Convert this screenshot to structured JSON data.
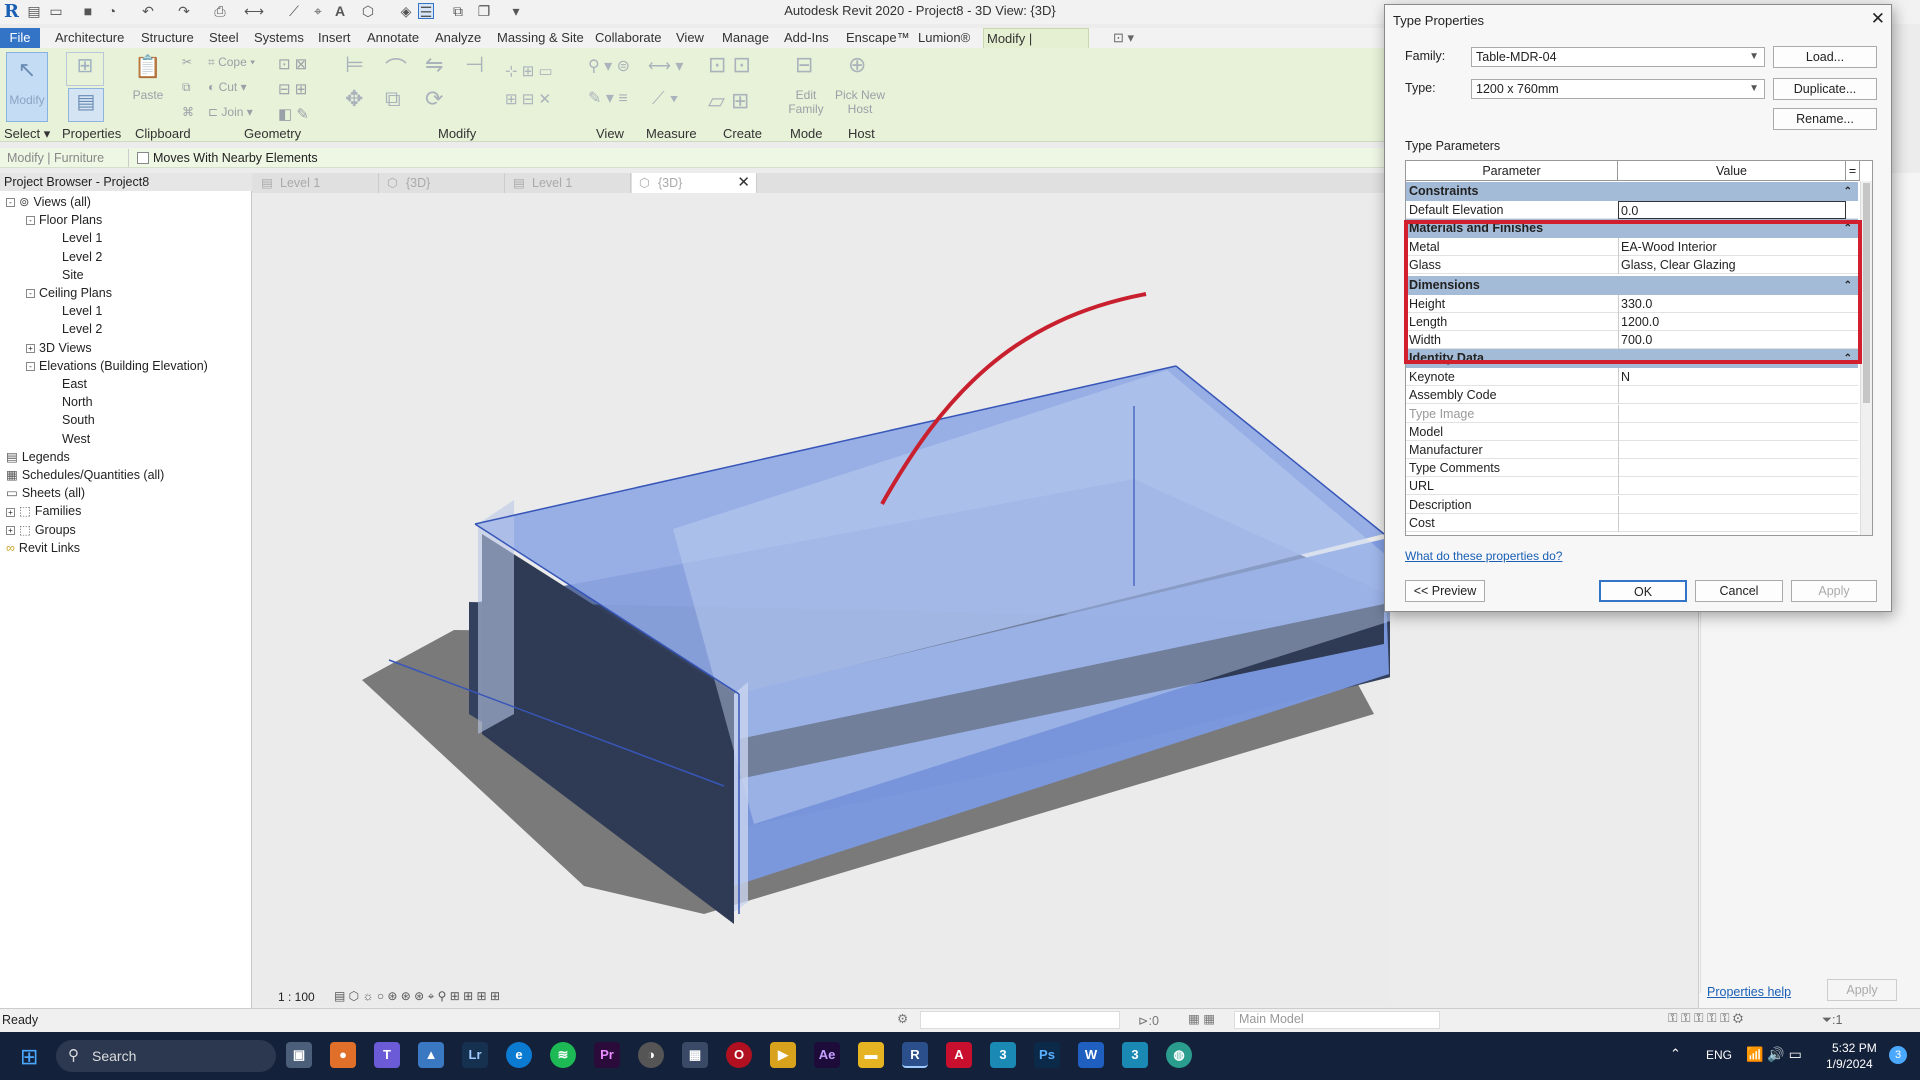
{
  "app": {
    "title": "Autodesk Revit 2020 - Project8 - 3D View: {3D}",
    "logo": "R"
  },
  "tabs": [
    "File",
    "Architecture",
    "Structure",
    "Steel",
    "Systems",
    "Insert",
    "Annotate",
    "Analyze",
    "Massing & Site",
    "Collaborate",
    "View",
    "Manage",
    "Add-Ins",
    "Enscape™",
    "Lumion®",
    "Modify | Furniture"
  ],
  "ribbon": {
    "modify_label": "Modify",
    "properties_label": "Properties",
    "paste_label": "Paste",
    "cope_label": "Cope",
    "cut_label": "Cut",
    "join_label": "Join",
    "edit_family_label": "Edit Family",
    "pick_new_host_label": "Pick New Host",
    "groups": [
      "Select",
      "Properties",
      "Clipboard",
      "Geometry",
      "Modify",
      "View",
      "Measure",
      "Create",
      "Mode",
      "Host"
    ]
  },
  "options_bar": {
    "context": "Modify | Furniture",
    "checkbox_label": "Moves With Nearby Elements"
  },
  "project_browser": {
    "header": "Project Browser - Project8",
    "items": [
      {
        "label": "Views (all)",
        "level": 0,
        "toggle": "-"
      },
      {
        "label": "Floor Plans",
        "level": 1,
        "toggle": "-"
      },
      {
        "label": "Level 1",
        "level": 2
      },
      {
        "label": "Level 2",
        "level": 2
      },
      {
        "label": "Site",
        "level": 2
      },
      {
        "label": "Ceiling Plans",
        "level": 1,
        "toggle": "-"
      },
      {
        "label": "Level 1",
        "level": 2
      },
      {
        "label": "Level 2",
        "level": 2
      },
      {
        "label": "3D Views",
        "level": 1,
        "toggle": "+"
      },
      {
        "label": "Elevations (Building Elevation)",
        "level": 1,
        "toggle": "-"
      },
      {
        "label": "East",
        "level": 2
      },
      {
        "label": "North",
        "level": 2
      },
      {
        "label": "South",
        "level": 2
      },
      {
        "label": "West",
        "level": 2
      },
      {
        "label": "Legends",
        "level": 0
      },
      {
        "label": "Schedules/Quantities (all)",
        "level": 0
      },
      {
        "label": "Sheets (all)",
        "level": 0
      },
      {
        "label": "Families",
        "level": 0,
        "toggle": "+"
      },
      {
        "label": "Groups",
        "level": 0,
        "toggle": "+"
      },
      {
        "label": "Revit Links",
        "level": 0
      }
    ]
  },
  "view_tabs": [
    "Level 1",
    "{3D}",
    "Level 1",
    "{3D}"
  ],
  "view_controls": {
    "scale": "1 : 100"
  },
  "status_bar": {
    "status": "Ready",
    "selection_count": ":0",
    "model": "Main Model",
    "filter_count": ":1",
    "properties_help": "Properties help",
    "apply": "Apply"
  },
  "dialog": {
    "title": "Type Properties",
    "family_label": "Family:",
    "family_value": "Table-MDR-04",
    "type_label": "Type:",
    "type_value": "1200 x 760mm",
    "load_btn": "Load...",
    "duplicate_btn": "Duplicate...",
    "rename_btn": "Rename...",
    "type_parameters_label": "Type Parameters",
    "col_parameter": "Parameter",
    "col_value": "Value",
    "col_eq": "=",
    "sections": [
      {
        "name": "Constraints",
        "rows": [
          {
            "p": "Default Elevation",
            "v": "0.0"
          }
        ]
      },
      {
        "name": "Materials and Finishes",
        "rows": [
          {
            "p": "Metal",
            "v": "EA-Wood Interior"
          },
          {
            "p": "Glass",
            "v": "Glass, Clear Glazing"
          }
        ]
      },
      {
        "name": "Dimensions",
        "rows": [
          {
            "p": "Height",
            "v": "330.0"
          },
          {
            "p": "Length",
            "v": "1200.0"
          },
          {
            "p": "Width",
            "v": "700.0"
          }
        ]
      },
      {
        "name": "Identity Data",
        "rows": [
          {
            "p": "Keynote",
            "v": "N"
          },
          {
            "p": "Assembly Code",
            "v": ""
          },
          {
            "p": "Type Image",
            "v": ""
          },
          {
            "p": "Model",
            "v": ""
          },
          {
            "p": "Manufacturer",
            "v": ""
          },
          {
            "p": "Type Comments",
            "v": ""
          },
          {
            "p": "URL",
            "v": ""
          },
          {
            "p": "Description",
            "v": ""
          },
          {
            "p": "Cost",
            "v": ""
          }
        ]
      }
    ],
    "help_link": "What do these properties do?",
    "preview_btn": "<< Preview",
    "ok_btn": "OK",
    "cancel_btn": "Cancel",
    "apply_btn": "Apply"
  },
  "taskbar": {
    "search": "Search",
    "language": "ENG",
    "time": "5:32 PM",
    "date": "1/9/2024",
    "notifications": "3"
  },
  "colors": {
    "file_tab": "#3474c6",
    "ribbon": "#e8f2d8",
    "section_header": "#a3bbd6",
    "highlight": "#d11f2e",
    "taskbar": "#14213a"
  }
}
